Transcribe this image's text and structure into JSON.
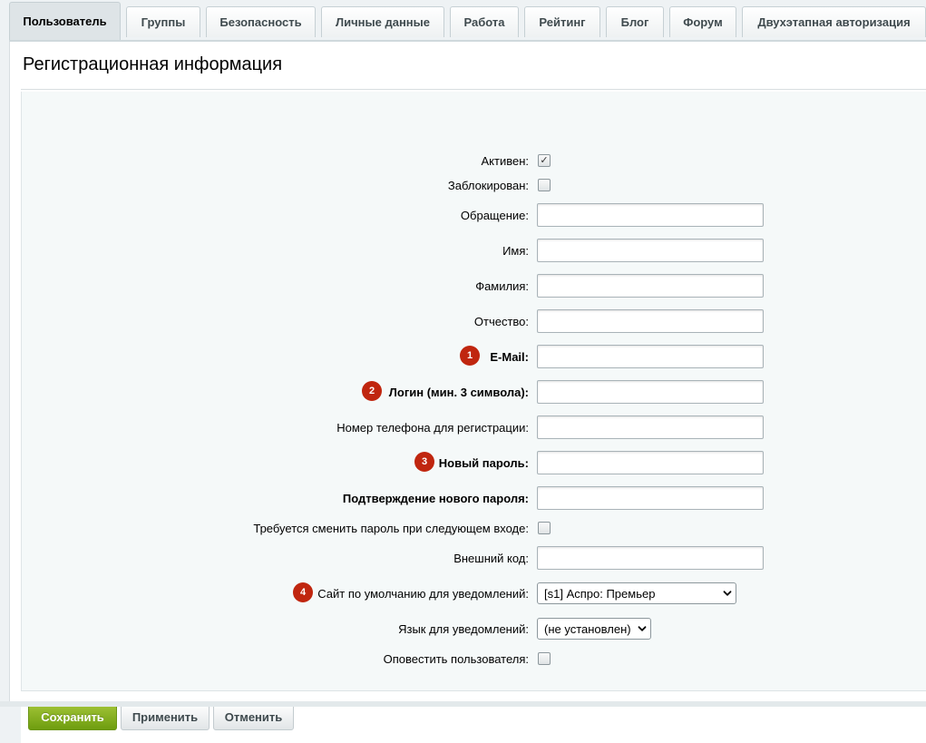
{
  "tabs": [
    {
      "label": "Пользователь",
      "active": true
    },
    {
      "label": "Группы"
    },
    {
      "label": "Безопасность"
    },
    {
      "label": "Личные данные"
    },
    {
      "label": "Работа"
    },
    {
      "label": "Рейтинг"
    },
    {
      "label": "Блог"
    },
    {
      "label": "Форум"
    },
    {
      "label": "Двухэтапная авторизация"
    }
  ],
  "section": {
    "title": "Регистрационная информация"
  },
  "fields": {
    "active": {
      "label": "Активен:",
      "checked": true
    },
    "blocked": {
      "label": "Заблокирован:",
      "checked": false
    },
    "salutation": {
      "label": "Обращение:",
      "value": ""
    },
    "first_name": {
      "label": "Имя:",
      "value": ""
    },
    "last_name": {
      "label": "Фамилия:",
      "value": ""
    },
    "middle_name": {
      "label": "Отчество:",
      "value": ""
    },
    "email": {
      "label": "E-Mail:",
      "value": "",
      "marker": "1",
      "required": true
    },
    "login": {
      "label": "Логин (мин. 3 символа):",
      "value": "",
      "marker": "2",
      "required": true
    },
    "phone": {
      "label": "Номер телефона для регистрации:",
      "value": ""
    },
    "new_password": {
      "label": "Новый пароль:",
      "value": "",
      "marker": "3",
      "required": true
    },
    "confirm_password": {
      "label": "Подтверждение нового пароля:",
      "value": "",
      "required": true
    },
    "change_password": {
      "label": "Требуется сменить пароль при следующем входе:",
      "checked": false
    },
    "external_code": {
      "label": "Внешний код:",
      "value": ""
    },
    "default_site": {
      "label": "Сайт по умолчанию для уведомлений:",
      "value": "[s1] Аспро: Премьер",
      "marker": "4"
    },
    "language": {
      "label": "Язык для уведомлений:",
      "value": "(не установлен)"
    },
    "notify_user": {
      "label": "Оповестить пользователя:",
      "checked": false
    }
  },
  "buttons": {
    "save": "Сохранить",
    "apply": "Применить",
    "cancel": "Отменить"
  },
  "colors": {
    "marker": "#c0260f",
    "save_button": "#8ab422",
    "form_background": "#f5f9f9"
  }
}
